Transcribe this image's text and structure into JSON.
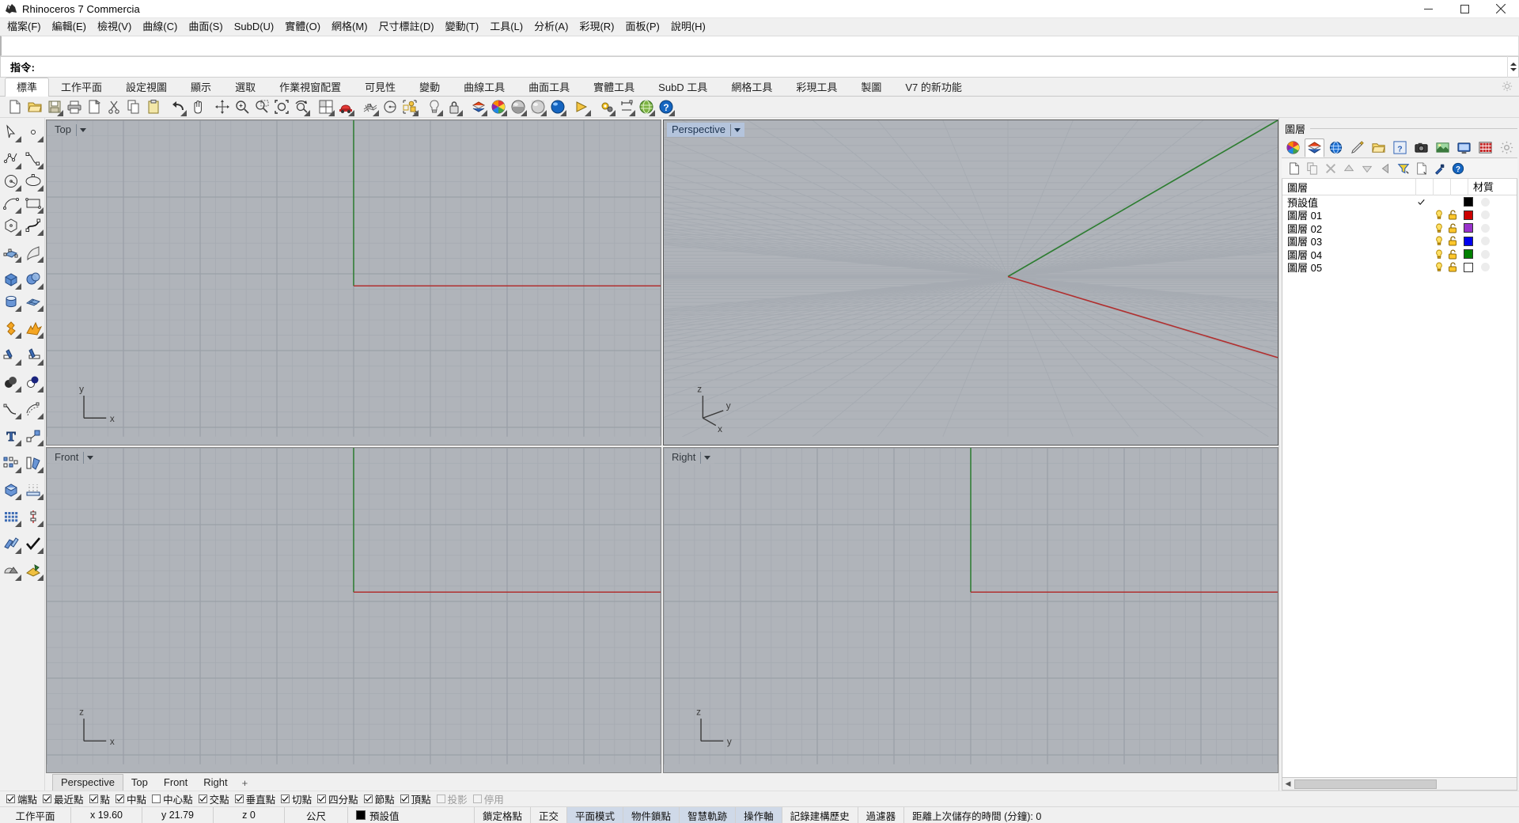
{
  "window": {
    "title": "Rhinoceros 7 Commercia",
    "app_icon": "rhino-logo-icon",
    "buttons": {
      "minimize": "minimize-icon",
      "maximize": "maximize-icon",
      "close": "close-icon"
    }
  },
  "menubar": [
    {
      "label": "檔案(F)"
    },
    {
      "label": "編輯(E)"
    },
    {
      "label": "檢視(V)"
    },
    {
      "label": "曲線(C)"
    },
    {
      "label": "曲面(S)"
    },
    {
      "label": "SubD(U)"
    },
    {
      "label": "實體(O)"
    },
    {
      "label": "網格(M)"
    },
    {
      "label": "尺寸標註(D)"
    },
    {
      "label": "變動(T)"
    },
    {
      "label": "工具(L)"
    },
    {
      "label": "分析(A)"
    },
    {
      "label": "彩現(R)"
    },
    {
      "label": "面板(P)"
    },
    {
      "label": "說明(H)"
    }
  ],
  "command": {
    "prompt": "指令:",
    "value": "",
    "placeholder": "",
    "history": ""
  },
  "tabs": [
    {
      "label": "標準",
      "active": true
    },
    {
      "label": "工作平面",
      "active": false
    },
    {
      "label": "設定視圖",
      "active": false
    },
    {
      "label": "顯示",
      "active": false
    },
    {
      "label": "選取",
      "active": false
    },
    {
      "label": "作業視窗配置",
      "active": false
    },
    {
      "label": "可見性",
      "active": false
    },
    {
      "label": "變動",
      "active": false
    },
    {
      "label": "曲線工具",
      "active": false
    },
    {
      "label": "曲面工具",
      "active": false
    },
    {
      "label": "實體工具",
      "active": false
    },
    {
      "label": "SubD 工具",
      "active": false
    },
    {
      "label": "網格工具",
      "active": false
    },
    {
      "label": "彩現工具",
      "active": false
    },
    {
      "label": "製圖",
      "active": false
    },
    {
      "label": "V7 的新功能",
      "active": false
    }
  ],
  "toolbar": {
    "gear": "gear-icon",
    "items": [
      {
        "name": "new-file-icon",
        "flyout": false
      },
      {
        "name": "open-file-icon",
        "flyout": false
      },
      {
        "name": "save-file-icon",
        "flyout": true
      },
      {
        "name": "print-icon",
        "flyout": false
      },
      {
        "name": "save-as-icon",
        "flyout": false
      },
      {
        "name": "cut-icon",
        "flyout": false
      },
      {
        "name": "copy-icon",
        "flyout": false
      },
      {
        "name": "paste-icon",
        "flyout": false
      },
      {
        "name": "undo-icon",
        "flyout": true
      },
      {
        "name": "pan-hand-icon",
        "flyout": false
      },
      {
        "name": "gumball-icon",
        "flyout": false
      },
      {
        "name": "zoom-in-icon",
        "flyout": false
      },
      {
        "name": "zoom-window-icon",
        "flyout": false
      },
      {
        "name": "zoom-extents-icon",
        "flyout": false
      },
      {
        "name": "zoom-selected-icon",
        "flyout": true
      },
      {
        "name": "viewport-layout-icon",
        "flyout": true
      },
      {
        "name": "render-car-icon",
        "flyout": true
      },
      {
        "name": "grid-snap-icon",
        "flyout": true
      },
      {
        "name": "circle-center-icon",
        "flyout": false
      },
      {
        "name": "select-objects-icon",
        "flyout": true
      },
      {
        "name": "light-bulb-icon",
        "flyout": true
      },
      {
        "name": "lock-icon",
        "flyout": true
      },
      {
        "name": "layers-icon",
        "flyout": true
      },
      {
        "name": "color-wheel-icon",
        "flyout": true
      },
      {
        "name": "shaded-sphere-icon",
        "flyout": true
      },
      {
        "name": "ghosted-sphere-icon",
        "flyout": true
      },
      {
        "name": "rendered-sphere-icon",
        "flyout": true
      },
      {
        "name": "direction-arrow-icon",
        "flyout": true
      },
      {
        "name": "options-gears-icon",
        "flyout": true
      },
      {
        "name": "dimension-icon",
        "flyout": true
      },
      {
        "name": "globe-render-icon",
        "flyout": true
      },
      {
        "name": "help-icon",
        "flyout": true
      }
    ]
  },
  "left_toolbar": {
    "items": [
      {
        "name": "select-arrow-icon"
      },
      {
        "name": "point-icon"
      },
      {
        "name": "polyline-icon"
      },
      {
        "name": "control-point-curve-icon"
      },
      {
        "name": "circle-icon"
      },
      {
        "name": "ellipse-icon"
      },
      {
        "name": "arc-icon"
      },
      {
        "name": "rectangle-icon"
      },
      {
        "name": "polygon-icon"
      },
      {
        "name": "curve-interpolate-icon"
      },
      {
        "name": "surface-control-points-icon"
      },
      {
        "name": "surface-loft-icon"
      },
      {
        "name": "box-icon"
      },
      {
        "name": "sphere-icon"
      },
      {
        "name": "cylinder-icon"
      },
      {
        "name": "surface-network-icon"
      },
      {
        "name": "mesh-primitive-icon"
      },
      {
        "name": "explode-icon"
      },
      {
        "name": "trim-icon"
      },
      {
        "name": "split-icon"
      },
      {
        "name": "boolean-union-icon"
      },
      {
        "name": "boolean-difference-icon"
      },
      {
        "name": "fillet-curve-icon"
      },
      {
        "name": "offset-curve-icon"
      },
      {
        "name": "text-icon"
      },
      {
        "name": "scale-icon"
      },
      {
        "name": "array-icon"
      },
      {
        "name": "mirror-icon"
      },
      {
        "name": "cap-planar-holes-icon"
      },
      {
        "name": "extrude-icon"
      },
      {
        "name": "array-grid-icon"
      },
      {
        "name": "dimension-linear-icon"
      },
      {
        "name": "join-icon"
      },
      {
        "name": "check-object-icon"
      },
      {
        "name": "render-mesh-icon"
      },
      {
        "name": "render-preview-icon"
      }
    ]
  },
  "viewports": [
    {
      "name": "Top",
      "active": false,
      "axes": [
        "y",
        "x"
      ],
      "gizmo": "top-axis-gizmo"
    },
    {
      "name": "Perspective",
      "active": true,
      "axes": [
        "z",
        "y",
        "x"
      ],
      "gizmo": "perspective-axis-gizmo"
    },
    {
      "name": "Front",
      "active": false,
      "axes": [
        "z",
        "x"
      ],
      "gizmo": "front-axis-gizmo"
    },
    {
      "name": "Right",
      "active": false,
      "axes": [
        "z",
        "y"
      ],
      "gizmo": "right-axis-gizmo"
    }
  ],
  "viewport_tabs": [
    {
      "label": "Perspective",
      "active": true
    },
    {
      "label": "Top",
      "active": false
    },
    {
      "label": "Front",
      "active": false
    },
    {
      "label": "Right",
      "active": false
    },
    {
      "label": "+",
      "active": false
    }
  ],
  "panel": {
    "title": "圖層",
    "tab_icons": [
      {
        "name": "color-wheel-panel-icon",
        "selected": false
      },
      {
        "name": "layers-panel-icon",
        "selected": true
      },
      {
        "name": "environment-panel-icon",
        "selected": false
      },
      {
        "name": "materials-brush-panel-icon",
        "selected": false
      },
      {
        "name": "folder-panel-icon",
        "selected": false
      },
      {
        "name": "help-panel-icon",
        "selected": false
      },
      {
        "name": "camera-panel-icon",
        "selected": false
      },
      {
        "name": "render-panel-icon",
        "selected": false
      },
      {
        "name": "display-panel-icon",
        "selected": false
      },
      {
        "name": "grid-panel-icon",
        "selected": false
      },
      {
        "name": "panel-options-gear-icon",
        "selected": false
      }
    ],
    "tool_icons": [
      {
        "name": "new-layer-icon"
      },
      {
        "name": "duplicate-layer-icon"
      },
      {
        "name": "delete-layer-icon"
      },
      {
        "name": "move-layer-up-icon"
      },
      {
        "name": "move-layer-down-icon"
      },
      {
        "name": "move-layer-left-icon"
      },
      {
        "name": "filter-layer-icon"
      },
      {
        "name": "layer-properties-icon"
      },
      {
        "name": "layer-tools-icon"
      },
      {
        "name": "layer-help-icon"
      }
    ],
    "columns": {
      "name": "圖層",
      "material": "材質"
    },
    "layers": [
      {
        "name": "預設值",
        "current": true,
        "visible": null,
        "locked": null,
        "color": "#000000",
        "material": true
      },
      {
        "name": "圖層 01",
        "current": false,
        "visible": true,
        "locked": false,
        "color": "#cc0000",
        "material": true
      },
      {
        "name": "圖層 02",
        "current": false,
        "visible": true,
        "locked": false,
        "color": "#9933cc",
        "material": true
      },
      {
        "name": "圖層 03",
        "current": false,
        "visible": true,
        "locked": false,
        "color": "#0000ee",
        "material": true
      },
      {
        "name": "圖層 04",
        "current": false,
        "visible": true,
        "locked": false,
        "color": "#008000",
        "material": true
      },
      {
        "name": "圖層 05",
        "current": false,
        "visible": true,
        "locked": false,
        "color": "#ffffff",
        "material": true
      }
    ]
  },
  "osnap": [
    {
      "label": "端點",
      "checked": true,
      "enabled": true
    },
    {
      "label": "最近點",
      "checked": true,
      "enabled": true
    },
    {
      "label": "點",
      "checked": true,
      "enabled": true
    },
    {
      "label": "中點",
      "checked": true,
      "enabled": true
    },
    {
      "label": "中心點",
      "checked": false,
      "enabled": true
    },
    {
      "label": "交點",
      "checked": true,
      "enabled": true
    },
    {
      "label": "垂直點",
      "checked": true,
      "enabled": true
    },
    {
      "label": "切點",
      "checked": true,
      "enabled": true
    },
    {
      "label": "四分點",
      "checked": true,
      "enabled": true
    },
    {
      "label": "節點",
      "checked": true,
      "enabled": true
    },
    {
      "label": "頂點",
      "checked": true,
      "enabled": true
    },
    {
      "label": "投影",
      "checked": false,
      "enabled": false
    },
    {
      "label": "停用",
      "checked": false,
      "enabled": false
    }
  ],
  "statusbar": {
    "cplane": "工作平面",
    "x": "x 19.60",
    "y": "y 21.79",
    "z": "z 0",
    "units": "公尺",
    "layer_color": "#000000",
    "layer": "預設值",
    "toggles": [
      {
        "label": "鎖定格點",
        "on": false
      },
      {
        "label": "正交",
        "on": false
      },
      {
        "label": "平面模式",
        "on": true
      },
      {
        "label": "物件鎖點",
        "on": true
      },
      {
        "label": "智慧軌跡",
        "on": true
      },
      {
        "label": "操作軸",
        "on": true
      },
      {
        "label": "記錄建構歷史",
        "on": false
      },
      {
        "label": "過濾器",
        "on": false
      }
    ],
    "autosave": "距離上次儲存的時間 (分鐘): 0"
  },
  "colors": {
    "viewport_bg": "#b0b4ba",
    "grid_minor": "#a3a8af",
    "grid_major": "#9aa0a7",
    "axis_x": "#b03030",
    "axis_y": "#2e7d32",
    "accent_blue": "#b4c4dc",
    "panel_bg": "#f0f0f0"
  }
}
